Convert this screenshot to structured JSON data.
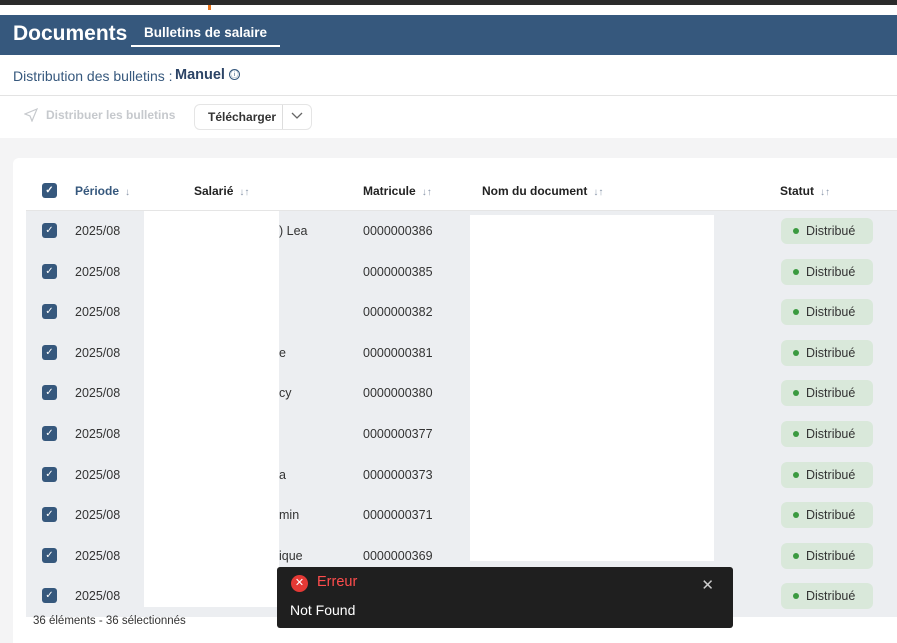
{
  "header": {
    "title": "Documents",
    "tab": "Bulletins de salaire"
  },
  "distribution": {
    "label": "Distribution des bulletins :",
    "value": "Manuel",
    "info_icon": "ⓘ"
  },
  "toolbar": {
    "distribute_label": "Distribuer les bulletins",
    "download_label": "Télécharger"
  },
  "table": {
    "columns": [
      "Période",
      "Salarié",
      "Matricule",
      "Nom du document",
      "Statut"
    ],
    "rows": [
      {
        "period": "2025/08",
        "employee": ") Lea",
        "id": "0000000386",
        "status": "Distribué"
      },
      {
        "period": "2025/08",
        "employee": "",
        "id": "0000000385",
        "status": "Distribué"
      },
      {
        "period": "2025/08",
        "employee": "",
        "id": "0000000382",
        "status": "Distribué"
      },
      {
        "period": "2025/08",
        "employee": "e",
        "id": "0000000381",
        "status": "Distribué"
      },
      {
        "period": "2025/08",
        "employee": "cy",
        "id": "0000000380",
        "status": "Distribué"
      },
      {
        "period": "2025/08",
        "employee": "",
        "id": "0000000377",
        "status": "Distribué"
      },
      {
        "period": "2025/08",
        "employee": "a",
        "id": "0000000373",
        "status": "Distribué"
      },
      {
        "period": "2025/08",
        "employee": "min",
        "id": "0000000371",
        "status": "Distribué"
      },
      {
        "period": "2025/08",
        "employee": "ique",
        "id": "0000000369",
        "status": "Distribué"
      },
      {
        "period": "2025/08",
        "employee": "",
        "id": "",
        "status": "Distribué"
      }
    ]
  },
  "footer": {
    "count": "36 éléments - 36 sélectionnés"
  },
  "toast": {
    "title": "Erreur",
    "message": "Not Found"
  },
  "colors": {
    "header": "#36587d",
    "status_dot": "#3a9a3f",
    "error": "#e53935"
  }
}
